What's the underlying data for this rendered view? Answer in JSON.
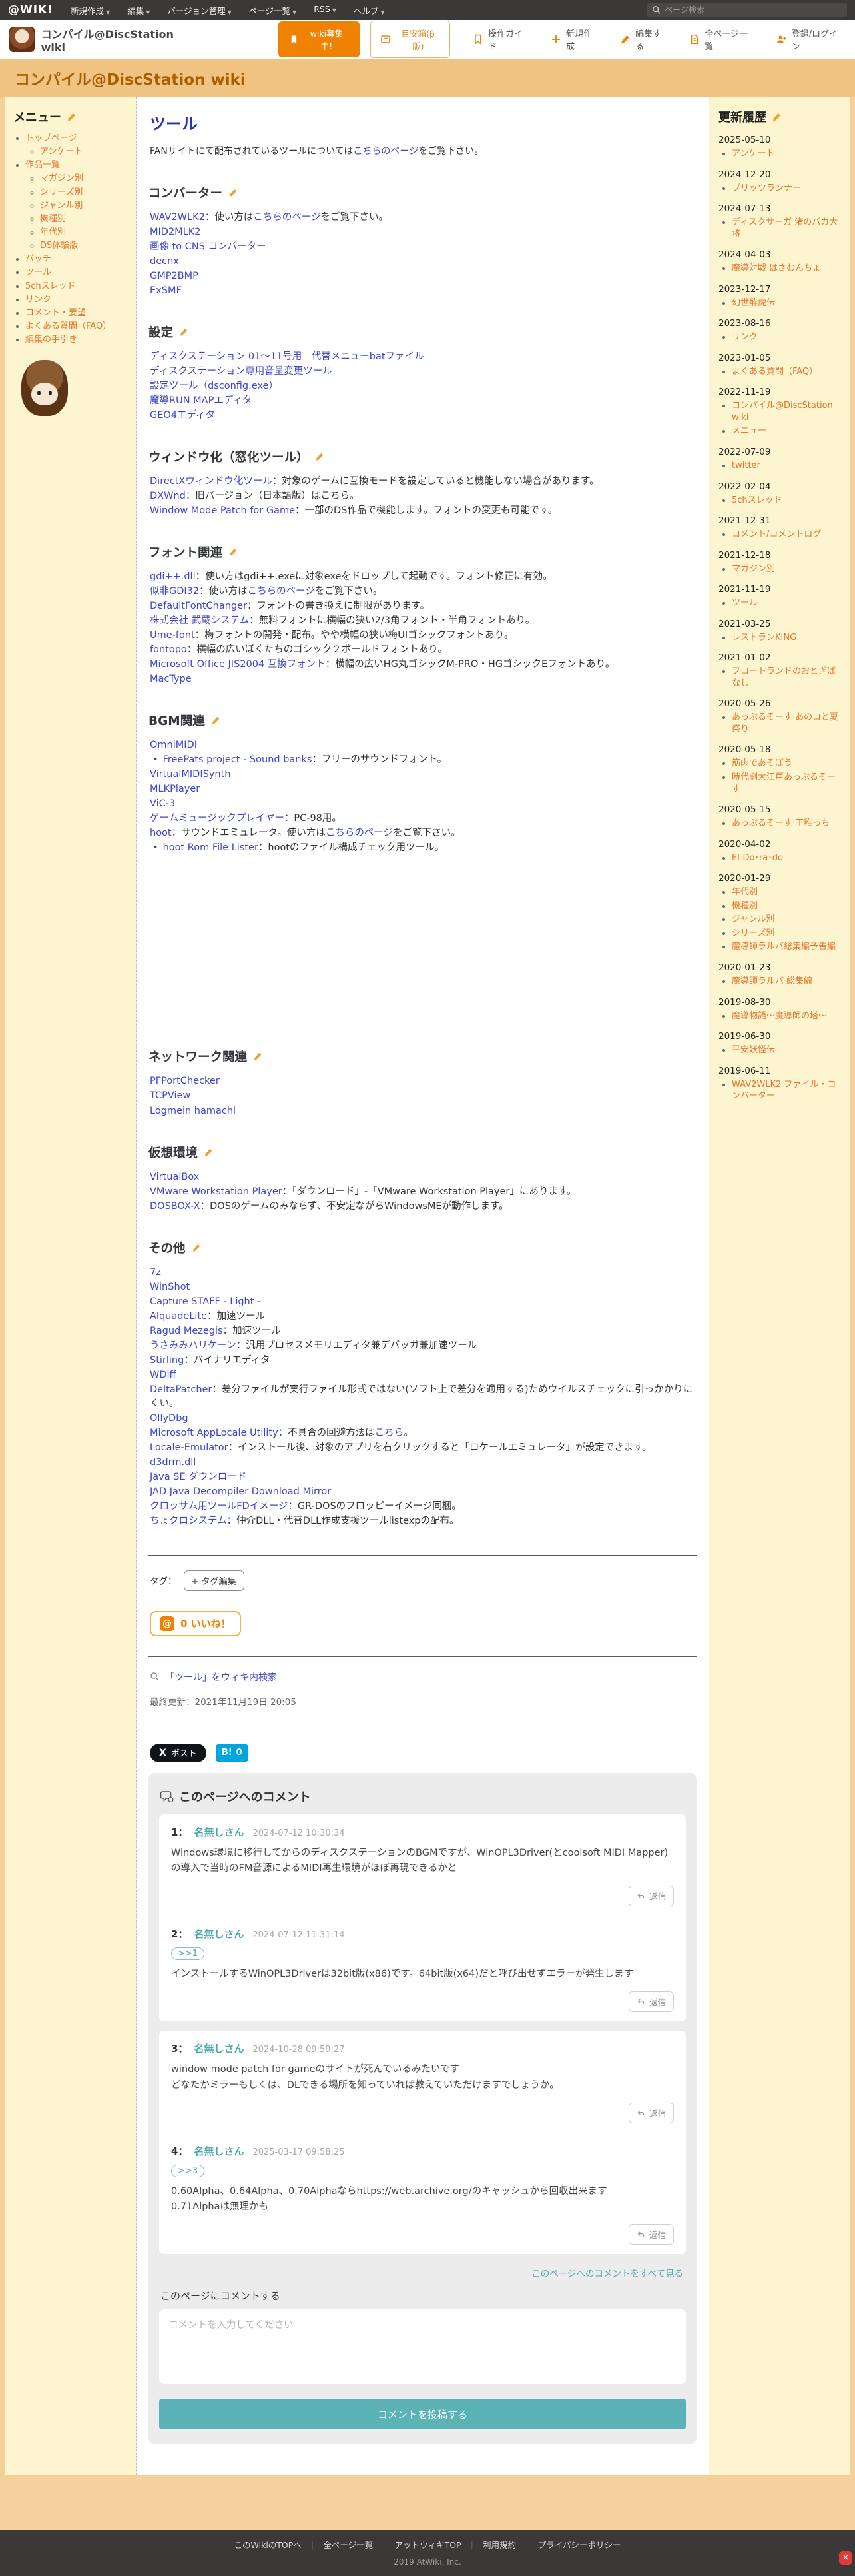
{
  "colors": {
    "brand_orange": "#ef8200",
    "link_blue": "#3d46c8",
    "sidebar_link_orange": "#e8732b",
    "teal": "#4fa8b0",
    "hatena_blue": "#00a4de",
    "banner_tan": "#f1c383",
    "heading_blue": "#2334ae"
  },
  "topbar": {
    "logo": "@WIK!",
    "menu": [
      "新規作成",
      "編集",
      "バージョン管理",
      "ページ一覧",
      "RSS",
      "ヘルプ"
    ],
    "search_placeholder": "ページ検索"
  },
  "header": {
    "site_title": "コンパイル@DiscStation wiki",
    "recruit_button": "wiki募集中!",
    "suggestion_button": "目安箱(β版)",
    "links": [
      "操作ガイド",
      "新規作成",
      "編集する",
      "全ページ一覧",
      "登録/ログイン"
    ]
  },
  "banner": {
    "title": "コンパイル@DiscStation wiki"
  },
  "sidebar": {
    "title": "メニュー",
    "items": [
      {
        "label": "トップページ",
        "depth": 1
      },
      {
        "label": "アンケート",
        "depth": 2
      },
      {
        "label": "作品一覧",
        "depth": 1
      },
      {
        "label": "マガジン別",
        "depth": 2
      },
      {
        "label": "シリーズ別",
        "depth": 2
      },
      {
        "label": "ジャンル別",
        "depth": 2
      },
      {
        "label": "機種別",
        "depth": 2
      },
      {
        "label": "年代別",
        "depth": 2
      },
      {
        "label": "DS体験版",
        "depth": 2
      },
      {
        "label": "パッチ",
        "depth": 1
      },
      {
        "label": "ツール",
        "depth": 1
      },
      {
        "label": "5chスレッド",
        "depth": 1
      },
      {
        "label": "リンク",
        "depth": 1
      },
      {
        "label": "コメント・要望",
        "depth": 1
      },
      {
        "label": "よくある質問（FAQ）",
        "depth": 1
      },
      {
        "label": "編集の手引き",
        "depth": 1
      }
    ]
  },
  "main": {
    "page_title": "ツール",
    "intro": [
      {
        "t": "FANサイトにて配布されているツールについては"
      },
      {
        "t": "こちらのページ",
        "link": true
      },
      {
        "t": "をご覧下さい。"
      }
    ],
    "sections": [
      {
        "heading": "コンバーター",
        "lines": [
          {
            "seg": [
              {
                "t": "WAV2WLK2",
                "link": true
              },
              {
                "t": "：使い方は"
              },
              {
                "t": "こちらのページ",
                "link": true
              },
              {
                "t": "をご覧下さい。"
              }
            ]
          },
          {
            "seg": [
              {
                "t": "MID2MLK2",
                "link": true
              }
            ]
          },
          {
            "seg": [
              {
                "t": "画像 to CNS コンバーター",
                "link": true
              }
            ]
          },
          {
            "seg": [
              {
                "t": "decnx",
                "link": true
              }
            ]
          },
          {
            "seg": [
              {
                "t": "GMP2BMP",
                "link": true
              }
            ]
          },
          {
            "seg": [
              {
                "t": "ExSMF",
                "link": true
              }
            ]
          }
        ]
      },
      {
        "heading": "設定",
        "lines": [
          {
            "seg": [
              {
                "t": "ディスクステーション 01～11号用　代替メニューbatファイル",
                "link": true
              }
            ]
          },
          {
            "seg": [
              {
                "t": "ディスクステーション専用音量変更ツール",
                "link": true
              }
            ]
          },
          {
            "seg": [
              {
                "t": "設定ツール（dsconfig.exe）",
                "link": true
              }
            ]
          },
          {
            "seg": [
              {
                "t": "魔導RUN MAPエディタ",
                "link": true
              }
            ]
          },
          {
            "seg": [
              {
                "t": "GEO4エディタ",
                "link": true
              }
            ]
          }
        ]
      },
      {
        "heading": "ウィンドウ化（窓化ツール）",
        "lines": [
          {
            "seg": [
              {
                "t": "DirectXウィンドウ化ツール",
                "link": true
              },
              {
                "t": "：対象のゲームに互換モードを設定していると機能しない場合があります。"
              }
            ]
          },
          {
            "seg": [
              {
                "t": "DXWnd",
                "link": true
              },
              {
                "t": "：旧バージョン（日本語版）はこちら。"
              }
            ]
          },
          {
            "seg": [
              {
                "t": "Window Mode Patch for Game",
                "link": true
              },
              {
                "t": "：一部のDS作品で機能します。フォントの変更も可能です。"
              }
            ]
          }
        ]
      },
      {
        "heading": "フォント関連",
        "lines": [
          {
            "seg": [
              {
                "t": "gdi++.dll",
                "link": true
              },
              {
                "t": "：使い方はgdi++.exeに対象exeをドロップして起動です。フォント修正に有効。"
              }
            ]
          },
          {
            "seg": [
              {
                "t": "似非GDI32",
                "link": true
              },
              {
                "t": "：使い方は"
              },
              {
                "t": "こちらのページ",
                "link": true
              },
              {
                "t": "をご覧下さい。"
              }
            ]
          },
          {
            "seg": [
              {
                "t": "DefaultFontChanger",
                "link": true
              },
              {
                "t": "：フォントの書き換えに制限があります。"
              }
            ]
          },
          {
            "seg": [
              {
                "t": "株式会社 武蔵システム",
                "link": true
              },
              {
                "t": "：無料フォントに横幅の狭い2/3角フォント・半角フォントあり。"
              }
            ]
          },
          {
            "seg": [
              {
                "t": "Ume-font",
                "link": true
              },
              {
                "t": "：梅フォントの開発・配布。やや横幅の狭い梅UIゴシックフォントあり。"
              }
            ]
          },
          {
            "seg": [
              {
                "t": "fontopo",
                "link": true
              },
              {
                "t": "：横幅の広いぼくたちのゴシック２ボールドフォントあり。"
              }
            ]
          },
          {
            "seg": [
              {
                "t": "Microsoft Office JIS2004 互換フォント",
                "link": true
              },
              {
                "t": "：横幅の広いHG丸ゴシックM-PRO・HGゴシックEフォントあり。"
              }
            ]
          },
          {
            "seg": [
              {
                "t": "MacType",
                "link": true
              }
            ]
          }
        ]
      },
      {
        "heading": "BGM関連",
        "gap_after": true,
        "lines": [
          {
            "seg": [
              {
                "t": "OmniMIDI",
                "link": true
              }
            ]
          },
          {
            "bullet": true,
            "seg": [
              {
                "t": "FreePats project - Sound banks",
                "link": true
              },
              {
                "t": "：フリーのサウンドフォント。"
              }
            ]
          },
          {
            "seg": [
              {
                "t": "VirtualMIDISynth",
                "link": true
              }
            ]
          },
          {
            "seg": [
              {
                "t": "MLKPlayer",
                "link": true
              }
            ]
          },
          {
            "seg": [
              {
                "t": "ViC-3",
                "link": true
              }
            ]
          },
          {
            "seg": [
              {
                "t": "ゲームミュージックプレイヤー",
                "link": true
              },
              {
                "t": "：PC-98用。"
              }
            ]
          },
          {
            "seg": [
              {
                "t": "hoot",
                "link": true
              },
              {
                "t": "：サウンドエミュレータ。使い方は"
              },
              {
                "t": "こちらのページ",
                "link": true
              },
              {
                "t": "をご覧下さい。"
              }
            ]
          },
          {
            "bullet": true,
            "seg": [
              {
                "t": "hoot Rom File Lister",
                "link": true
              },
              {
                "t": "：hootのファイル構成チェック用ツール。"
              }
            ]
          }
        ]
      },
      {
        "heading": "ネットワーク関連",
        "lines": [
          {
            "seg": [
              {
                "t": "PFPortChecker",
                "link": true
              }
            ]
          },
          {
            "seg": [
              {
                "t": "TCPView",
                "link": true
              }
            ]
          },
          {
            "seg": [
              {
                "t": "Logmein hamachi",
                "link": true
              }
            ]
          }
        ]
      },
      {
        "heading": "仮想環境",
        "lines": [
          {
            "seg": [
              {
                "t": "VirtualBox",
                "link": true
              }
            ]
          },
          {
            "seg": [
              {
                "t": "VMware Workstation Player",
                "link": true
              },
              {
                "t": "：「ダウンロード」-「VMware Workstation Player」にあります。"
              }
            ]
          },
          {
            "seg": [
              {
                "t": "DOSBOX-X",
                "link": true
              },
              {
                "t": "：DOSのゲームのみならず、不安定ながらWindowsMEが動作します。"
              }
            ]
          }
        ]
      },
      {
        "heading": "その他",
        "lines": [
          {
            "seg": [
              {
                "t": "7z",
                "link": true
              }
            ]
          },
          {
            "seg": [
              {
                "t": "WinShot",
                "link": true
              }
            ]
          },
          {
            "seg": [
              {
                "t": "Capture STAFF - Light -",
                "link": true
              }
            ]
          },
          {
            "seg": [
              {
                "t": "AlquadeLite",
                "link": true
              },
              {
                "t": "：加速ツール"
              }
            ]
          },
          {
            "seg": [
              {
                "t": "Ragud Mezegis",
                "link": true
              },
              {
                "t": "：加速ツール"
              }
            ]
          },
          {
            "seg": [
              {
                "t": "うさみみハリケーン",
                "link": true
              },
              {
                "t": "：汎用プロセスメモリエディタ兼デバッガ兼加速ツール"
              }
            ]
          },
          {
            "seg": [
              {
                "t": "Stirling",
                "link": true
              },
              {
                "t": "：バイナリエディタ"
              }
            ]
          },
          {
            "seg": [
              {
                "t": "WDiff",
                "link": true
              }
            ]
          },
          {
            "seg": [
              {
                "t": "DeltaPatcher",
                "link": true
              },
              {
                "t": "：差分ファイルが実行ファイル形式ではない(ソフト上で差分を適用する)ためウイルスチェックに引っかかりにくい。"
              }
            ]
          },
          {
            "seg": [
              {
                "t": "OllyDbg",
                "link": true
              }
            ]
          },
          {
            "seg": [
              {
                "t": "Microsoft AppLocale Utility",
                "link": true
              },
              {
                "t": "：不具合の回避方法は"
              },
              {
                "t": "こちら",
                "link": true
              },
              {
                "t": "。"
              }
            ]
          },
          {
            "seg": [
              {
                "t": "Locale-Emulator",
                "link": true
              },
              {
                "t": "：インストール後、対象のアプリを右クリックすると「ロケールエミュレータ」が設定できます。"
              }
            ]
          },
          {
            "seg": [
              {
                "t": "d3drm.dll",
                "link": true
              }
            ]
          },
          {
            "seg": [
              {
                "t": "Java SE ダウンロード",
                "link": true
              }
            ]
          },
          {
            "seg": [
              {
                "t": "JAD Java Decompiler Download Mirror",
                "link": true
              }
            ]
          },
          {
            "seg": [
              {
                "t": "クロッサム用ツールFDイメージ",
                "link": true
              },
              {
                "t": "：GR-DOSのフロッピーイメージ同梱。"
              }
            ]
          },
          {
            "seg": [
              {
                "t": "ちょクロシステム",
                "link": true
              },
              {
                "t": "：仲介DLL・代替DLL作成支援ツールlistexpの配布。"
              }
            ]
          }
        ]
      }
    ],
    "tags": {
      "label": "タグ：",
      "edit_button": "+ タグ編集"
    },
    "like": {
      "count_label": "0 いいね！",
      "badge": "@"
    },
    "wiki_search_link": "「ツール」をウィキ内検索",
    "last_update": "最終更新：2021年11月19日 20:05",
    "share": {
      "x_logo": "X",
      "x_label": "ポスト",
      "hatena_label": "B!",
      "hatena_count": "0"
    }
  },
  "comments": {
    "title": "このページへのコメント",
    "items": [
      {
        "num": "1：",
        "name": "名無しさん",
        "date": "2024-07-12 10:30:34",
        "reply_ref": "",
        "body": [
          "Windows環境に移行してからのディスクステーションのBGMですが、WinOPL3Driver(とcoolsoft MIDI Mapper)の導入で当時のFM音源によるMIDI再生環境がほぼ再現できるかと"
        ],
        "reply_label": "返信"
      },
      {
        "num": "2：",
        "name": "名無しさん",
        "date": "2024-07-12 11:31:14",
        "reply_ref": ">>1",
        "body": [
          "インストールするWinOPL3Driverは32bit版(x86)です。64bit版(x64)だと呼び出せずエラーが発生します"
        ],
        "reply_label": "返信"
      },
      {
        "num": "3：",
        "name": "名無しさん",
        "date": "2024-10-28 09:59:27",
        "reply_ref": "",
        "body": [
          "window mode patch for gameのサイトが死んでいるみたいです",
          "どなたかミラーもしくは、DLできる場所を知っていれば教えていただけますでしょうか。"
        ],
        "reply_label": "返信"
      },
      {
        "num": "4：",
        "name": "名無しさん",
        "date": "2025-03-17 09:58:25",
        "reply_ref": ">>3",
        "body": [
          "0.60Alpha、0.64Alpha、0.70Alphaならhttps://web.archive.org/のキャッシュから回収出来ます",
          "0.71Alphaは無理かも"
        ],
        "reply_label": "返信"
      }
    ],
    "view_all": "このページへのコメントをすべて見る",
    "post_label": "このページにコメントする",
    "placeholder": "コメントを入力してください",
    "submit": "コメントを投稿する"
  },
  "updates": {
    "title": "更新履歴",
    "entries": [
      {
        "date": "2025-05-10",
        "pages": [
          "アンケート"
        ]
      },
      {
        "date": "2024-12-20",
        "pages": [
          "ブリッツランナー"
        ]
      },
      {
        "date": "2024-07-13",
        "pages": [
          "ディスクサーガ 渚のバカ大将"
        ]
      },
      {
        "date": "2024-04-03",
        "pages": [
          "魔導対戦 はさむんちょ"
        ]
      },
      {
        "date": "2023-12-17",
        "pages": [
          "幻世酔虎伝"
        ]
      },
      {
        "date": "2023-08-16",
        "pages": [
          "リンク"
        ]
      },
      {
        "date": "2023-01-05",
        "pages": [
          "よくある質問（FAQ）"
        ]
      },
      {
        "date": "2022-11-19",
        "pages": [
          "コンパイル@DiscStation wiki",
          "メニュー"
        ]
      },
      {
        "date": "2022-07-09",
        "pages": [
          "twitter"
        ]
      },
      {
        "date": "2022-02-04",
        "pages": [
          "5chスレッド"
        ]
      },
      {
        "date": "2021-12-31",
        "pages": [
          "コメント/コメントログ"
        ]
      },
      {
        "date": "2021-12-18",
        "pages": [
          "マガジン別"
        ]
      },
      {
        "date": "2021-11-19",
        "pages": [
          "ツール"
        ]
      },
      {
        "date": "2021-03-25",
        "pages": [
          "レストランKING"
        ]
      },
      {
        "date": "2021-01-02",
        "pages": [
          "フロートランドのおとぎばなし"
        ]
      },
      {
        "date": "2020-05-26",
        "pages": [
          "あっぷるそーす あのコと夏祭り"
        ]
      },
      {
        "date": "2020-05-18",
        "pages": [
          "筋肉であそぼう",
          "時代劇大江戸あっぷるそーす"
        ]
      },
      {
        "date": "2020-05-15",
        "pages": [
          "あっぷるそーす 丁稚っち"
        ]
      },
      {
        "date": "2020-04-02",
        "pages": [
          "El-Do･ra･do"
        ]
      },
      {
        "date": "2020-01-29",
        "pages": [
          "年代別",
          "機種別",
          "ジャンル別",
          "シリーズ別",
          "魔導師ラルバ総集編予告編"
        ]
      },
      {
        "date": "2020-01-23",
        "pages": [
          "魔導師ラルバ 総集編"
        ]
      },
      {
        "date": "2019-08-30",
        "pages": [
          "魔導物語～魔導師の塔～"
        ]
      },
      {
        "date": "2019-06-30",
        "pages": [
          "平安妖怪伝"
        ]
      },
      {
        "date": "2019-06-11",
        "pages": [
          "WAV2WLK2 ファイル・コンバーター"
        ]
      }
    ]
  },
  "footer": {
    "links": [
      "このWikiのTOPへ",
      "全ページ一覧",
      "アットウィキTOP",
      "利用規約",
      "プライバシーポリシー"
    ],
    "copyright": "2019 AtWiki, Inc.",
    "close_button": "×"
  }
}
